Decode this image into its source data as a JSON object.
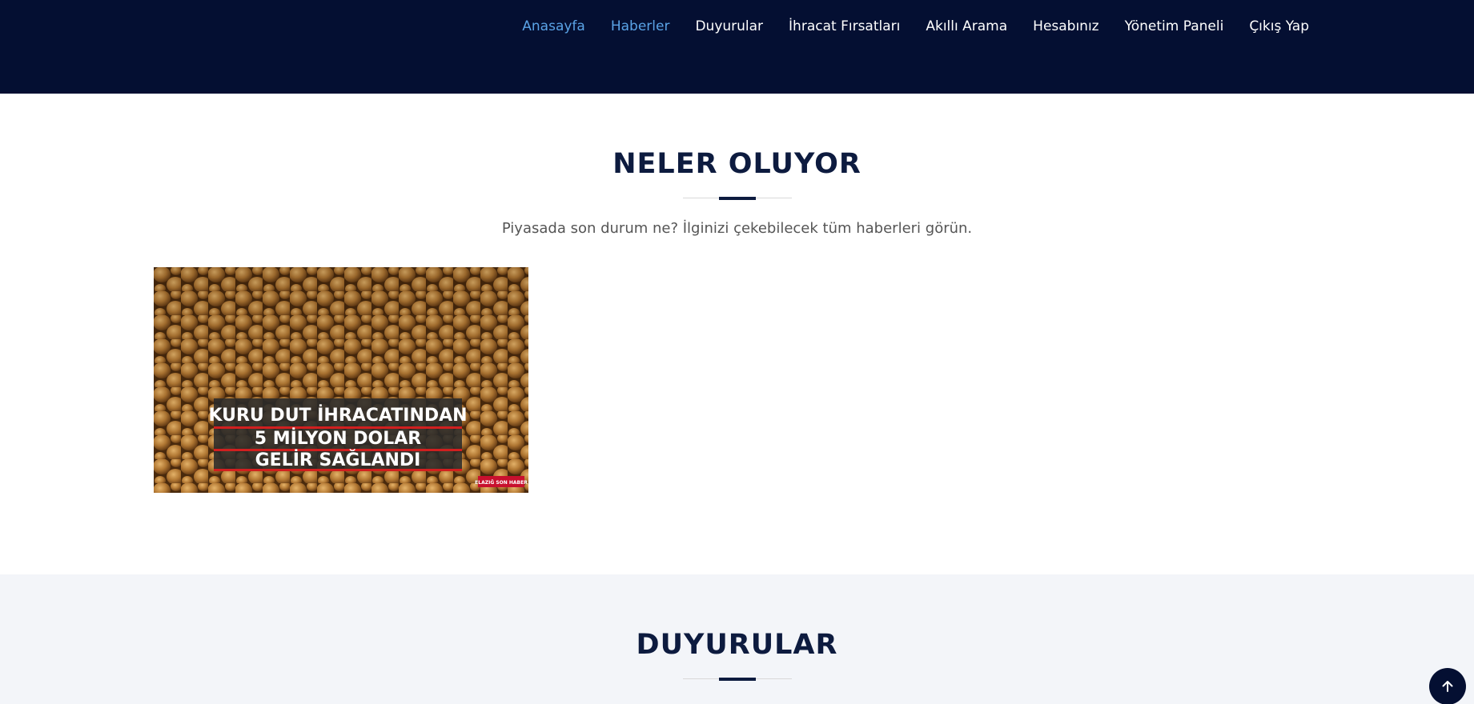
{
  "nav": {
    "items": [
      {
        "label": "Anasayfa",
        "active": true
      },
      {
        "label": "Haberler",
        "active": true
      },
      {
        "label": "Duyurular",
        "active": false
      },
      {
        "label": "İhracat Fırsatları",
        "active": false
      },
      {
        "label": "Akıllı Arama",
        "active": false
      },
      {
        "label": "Hesabınız",
        "active": false
      },
      {
        "label": "Yönetim Paneli",
        "active": false
      },
      {
        "label": "Çıkış Yap",
        "active": false
      }
    ]
  },
  "news_section": {
    "title": "NELER OLUYOR",
    "subtitle": "Piyasada son durum ne? İlginizi çekebilecek tüm haberleri görün.",
    "cards": [
      {
        "image_caption_lines": [
          "KURU DUT İHRACATINDAN",
          "5 MİLYON DOLAR",
          "GELİR SAĞLANDI"
        ],
        "image_watermark": "ELAZIĞ SON HABER"
      }
    ]
  },
  "announcements_section": {
    "title": "DUYURULAR"
  },
  "colors": {
    "header_bg": "#040f32",
    "nav_active": "#5aa3e6",
    "title": "#0d1b3f",
    "section_alt_bg": "#f3f5f9"
  },
  "icons": {
    "back_to_top": "arrow-up-icon"
  }
}
